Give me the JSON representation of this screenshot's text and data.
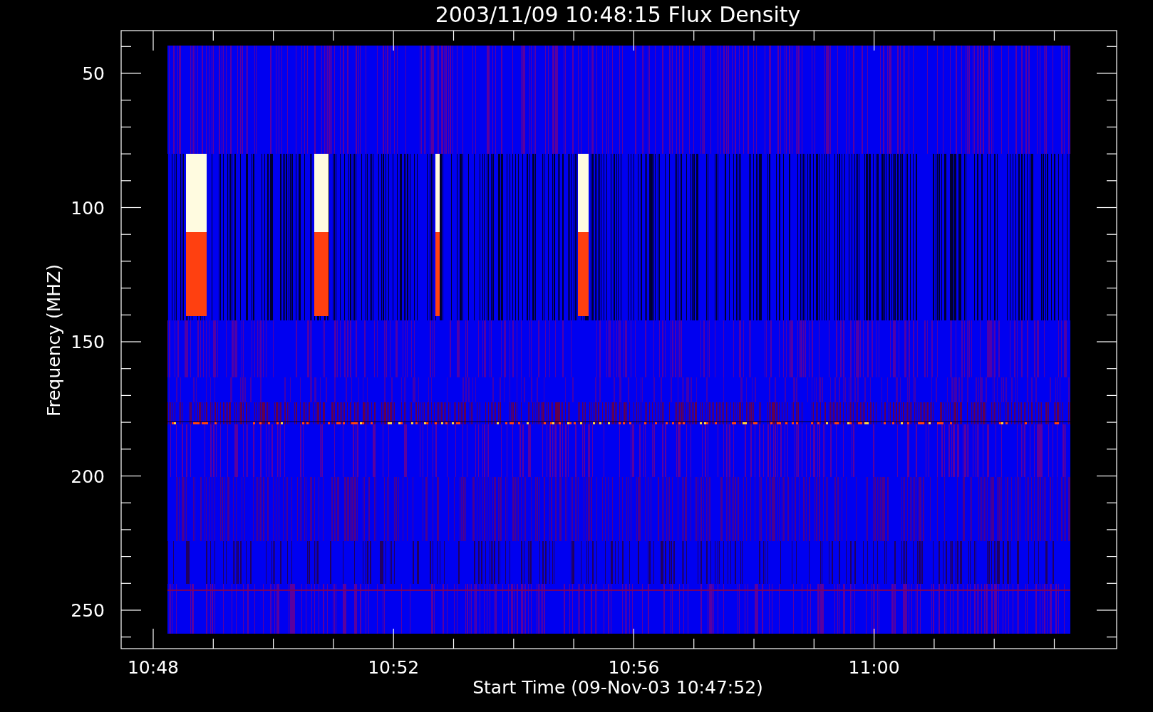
{
  "plot": {
    "title": "2003/11/09 10:48:15 Flux Density",
    "ylabel": "Frequency (MHZ)",
    "xlabel": "Start Time (09-Nov-03 10:47:52)",
    "yticks": [
      "50",
      "100",
      "150",
      "200",
      "250"
    ],
    "xticks": [
      "10:48",
      "10:52",
      "10:56",
      "11:00"
    ]
  }
}
